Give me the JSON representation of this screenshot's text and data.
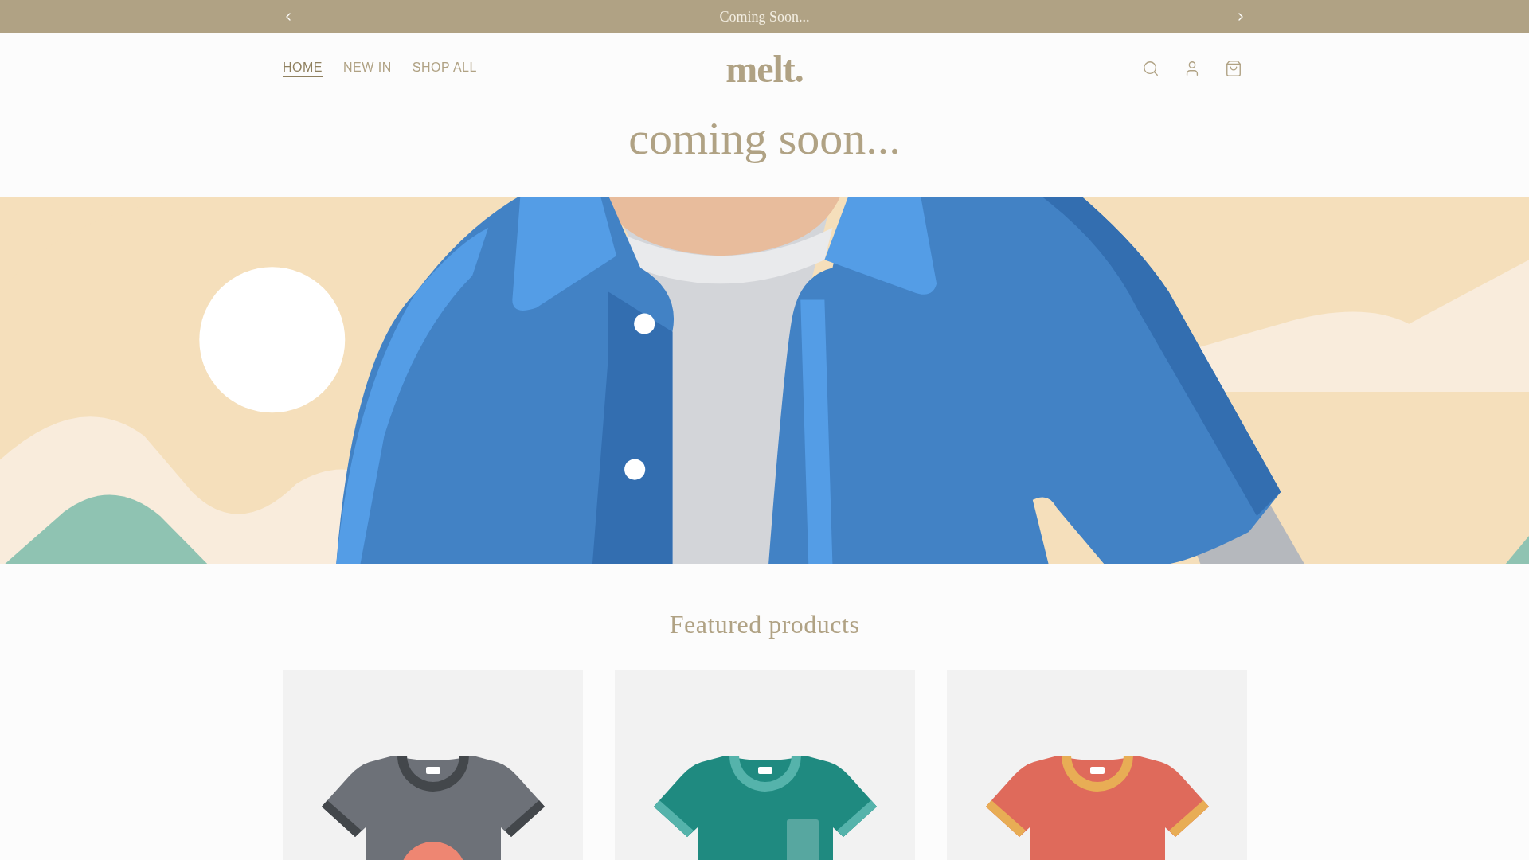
{
  "announcement": {
    "text": "Coming Soon..."
  },
  "nav": [
    {
      "label": "HOME",
      "selected": true
    },
    {
      "label": "NEW IN",
      "selected": false
    },
    {
      "label": "SHOP ALL",
      "selected": false
    }
  ],
  "logo": "melt.",
  "hero_title": "coming soon...",
  "featured": {
    "title": "Featured products",
    "products": [
      {
        "kind": "graphic",
        "color": "#6d7178"
      },
      {
        "kind": "pocket",
        "color": "#1f8a80"
      },
      {
        "kind": "plain",
        "color": "#df6a5b"
      }
    ]
  }
}
